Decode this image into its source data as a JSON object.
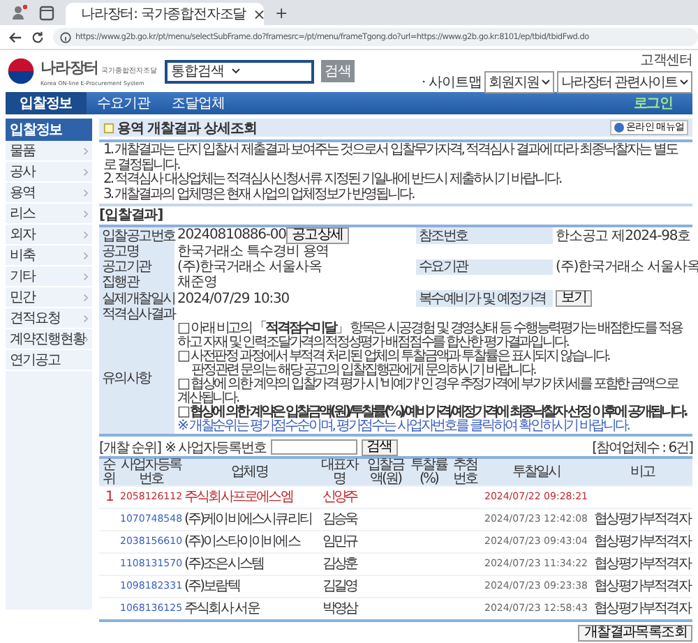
{
  "browser": {
    "tab_title": "나라장터: 국가종합전자조달",
    "tab_close": "×",
    "new_tab": "+",
    "url": "https://www.g2b.go.kr/pt/menu/selectSubFrame.do?framesrc=/pt/menu/frameTgong.do?url=https://www.g2b.go.kr:8101/ep/tbid/tbidFwd.do"
  },
  "header": {
    "logo_title": "나라장터",
    "logo_sub": "국가종합전자조달",
    "logo_en": "Korea ON-line E-Procurement System",
    "search_select": "통합검색",
    "search_button": "검색",
    "customer_center": "고객센터",
    "sitemap": "· 사이트맵",
    "select_1": "회원지원",
    "select_2": "나라장터 관련사이트"
  },
  "nav": {
    "items": [
      {
        "label": "입찰정보",
        "selected": true
      },
      {
        "label": "수요기관",
        "selected": false
      },
      {
        "label": "조달업체",
        "selected": false
      }
    ],
    "login": "로그인"
  },
  "sidebar": {
    "title": "입찰정보",
    "items": [
      {
        "label": "물품",
        "arrow": true
      },
      {
        "label": "공사",
        "arrow": true
      },
      {
        "label": "용역",
        "arrow": true
      },
      {
        "label": "리스",
        "arrow": true
      },
      {
        "label": "외자",
        "arrow": true
      },
      {
        "label": "비축",
        "arrow": true
      },
      {
        "label": "기타",
        "arrow": true
      },
      {
        "label": "민간",
        "arrow": true
      },
      {
        "label": "견적요청",
        "arrow": true
      },
      {
        "label": "계약진행현황",
        "arrow": true
      },
      {
        "label": "연기공고",
        "arrow": false
      }
    ]
  },
  "page_title": "용역 개찰결과 상세조회",
  "manual_button": "온라인 매뉴얼",
  "notices": [
    "1. 개찰결과는 단지 입찰서 제출결과 보여주는 것으로서 입찰무가자격, 적격심사 결과에 따라 최종낙찰자는 별도로 결정됩니다.",
    "2. 적격심사 대상업체는 적격심사신청서류 지정된 기일내에 반드시 제출하시기 바랍니다.",
    "3. 개찰결과의 업체명은 현재 사업의 업체정보가 반영됩니다."
  ],
  "bid_result": {
    "heading": "[입찰결과]",
    "rows": [
      {
        "cells": [
          {
            "label": "입찰공고번호",
            "value": "20240810886-00",
            "button": "공고상세"
          },
          {
            "label": "참조번호",
            "value": "한소공고 제2024-98호"
          }
        ]
      },
      {
        "cells": [
          {
            "label": "공고명",
            "value": "한국거래소 특수경비 용역"
          }
        ]
      },
      {
        "cells": [
          {
            "label": "공고기관",
            "value": "(주)한국거래소 서울사옥"
          },
          {
            "label": "수요기관",
            "value": "(주)한국거래소 서울사옥"
          }
        ]
      },
      {
        "cells": [
          {
            "label": "집행관",
            "value": "채준영"
          }
        ]
      },
      {
        "cells": [
          {
            "label": "실제개찰일시",
            "value": "2024/07/29 10:30"
          },
          {
            "label": "복수예비가 및 예정가격",
            "button": "보기"
          }
        ]
      },
      {
        "cells": [
          {
            "label": "적격심사결과"
          }
        ]
      }
    ],
    "remarks_label": "유의사항",
    "remarks": [
      {
        "kind": "normal",
        "text": "□ 아래 비고의 「**적격점수미달**」 항목은 시공경험 및 경영상태 등 수행능력평가는 배점한도를 적용하고 자재 및 인력조달가격의적정성평가 배점점수를 합산한 평가결과입니다."
      },
      {
        "kind": "normal",
        "text": "□ 사전판정 과정에서 부적격 처리된 업체의 투찰금액과 투찰률은 표시되지 않습니다."
      },
      {
        "kind": "indent",
        "text": "판정관련 문의는 해당 공고의 입찰집행관에게 문의하시기 바랍니다."
      },
      {
        "kind": "normal",
        "text": "□ 협상에 의한 계약의 입찰가격 평가 시 '비예가' 인 경우 추정가격에 부가가치세를 포함한 금액으로 계산됩니다."
      },
      {
        "kind": "bold",
        "text": "□ 협상에 의한 계약은 입찰금액(원)/투찰률(%)/예비가격/예정가격에 최종낙찰자 선정 이후에 공개됩니다."
      },
      {
        "kind": "blue",
        "text": "※ 개찰순위는 평가점수순이며, 평가점수는 사업자번호를 클릭하여 확인하시기 바랍니다."
      }
    ]
  },
  "ranking": {
    "heading": "[개찰 순위]",
    "filter_label": "※ 사업자등록번호",
    "search_button": "검색",
    "count": "[참여업체수 : 6건]",
    "columns": [
      "순위",
      "사업자등록번호",
      "업체명",
      "대표자명",
      "입찰금액(원)",
      "투찰률(%)",
      "추첨번호",
      "투찰일시",
      "비고"
    ],
    "rows": [
      {
        "highlighted": true,
        "rank": "1",
        "biz_no": "2058126112",
        "company": "주식회사프로에스엠",
        "ceo": "신양주",
        "time": "2024/07/22 09:28:21"
      },
      {
        "highlighted": false,
        "biz_no": "1070748548",
        "company": "(주)케이비에스시큐리티",
        "ceo": "김승욱",
        "time": "2024/07/23 12:42:08",
        "note": "협상평가부적격자"
      },
      {
        "highlighted": false,
        "biz_no": "2038156610",
        "company": "(주)이스타이이비에스",
        "ceo": "임민규",
        "time": "2024/07/23 09:43:04",
        "note": "협상평가부적격자"
      },
      {
        "highlighted": false,
        "biz_no": "1108131570",
        "company": "(주)조은시스템",
        "ceo": "김상훈",
        "time": "2024/07/23 11:34:22",
        "note": "협상평가부적격자"
      },
      {
        "highlighted": false,
        "biz_no": "1098182331",
        "company": "(주)보람텍",
        "ceo": "김길영",
        "time": "2024/07/23 09:23:38",
        "note": "협상평가부적격자"
      },
      {
        "highlighted": false,
        "biz_no": "1068136125",
        "company": "주식회사 서운",
        "ceo": "박영삼",
        "time": "2024/07/23 12:58:43",
        "note": "협상평가부적격자"
      }
    ]
  },
  "list_button": "개찰결과목록조회"
}
